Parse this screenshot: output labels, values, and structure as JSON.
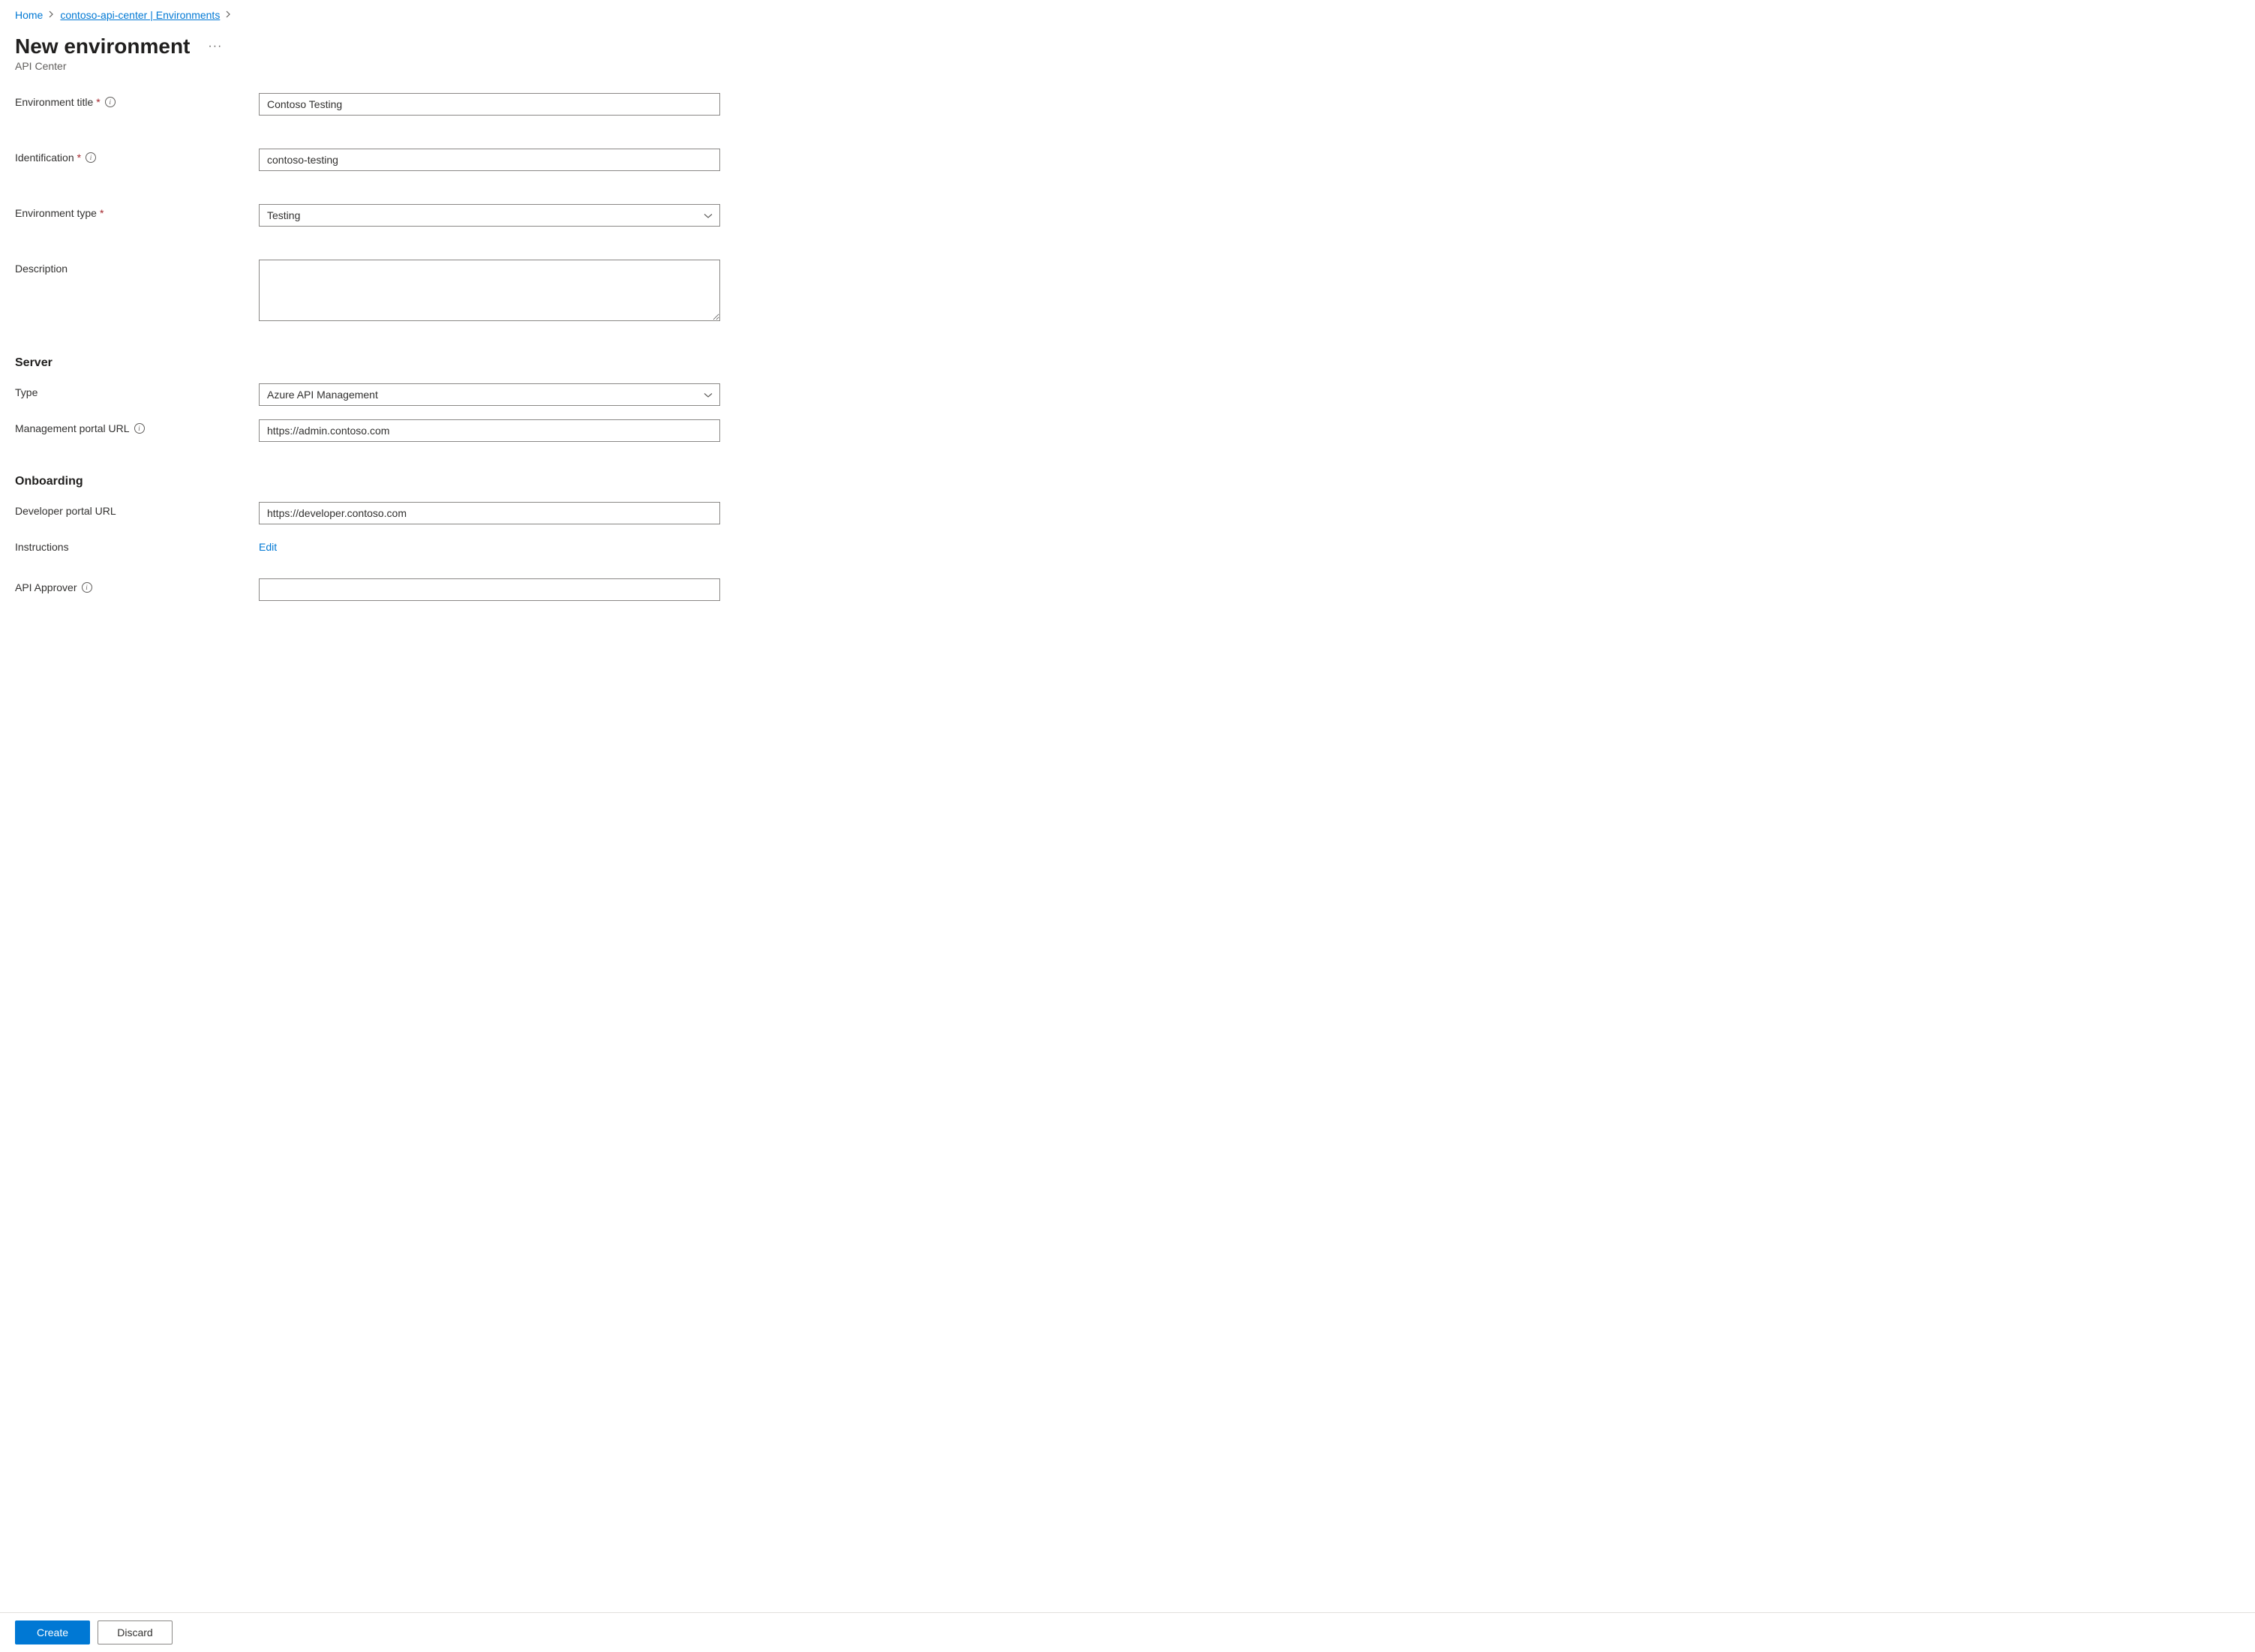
{
  "breadcrumb": {
    "home": "Home",
    "resource": "contoso-api-center | Environments"
  },
  "header": {
    "title": "New environment",
    "subtitle": "API Center"
  },
  "labels": {
    "environment_title": "Environment title",
    "identification": "Identification",
    "environment_type": "Environment type",
    "description": "Description",
    "type": "Type",
    "management_portal_url": "Management portal URL",
    "developer_portal_url": "Developer portal URL",
    "instructions": "Instructions",
    "api_approver": "API Approver"
  },
  "sections": {
    "server": "Server",
    "onboarding": "Onboarding"
  },
  "values": {
    "environment_title": "Contoso Testing",
    "identification": "contoso-testing",
    "environment_type": "Testing",
    "description": "",
    "server_type": "Azure API Management",
    "management_portal_url": "https://admin.contoso.com",
    "developer_portal_url": "https://developer.contoso.com",
    "api_approver": ""
  },
  "actions": {
    "edit": "Edit",
    "create": "Create",
    "discard": "Discard"
  },
  "symbols": {
    "required": "*",
    "info": "i",
    "ellipsis": "···"
  }
}
